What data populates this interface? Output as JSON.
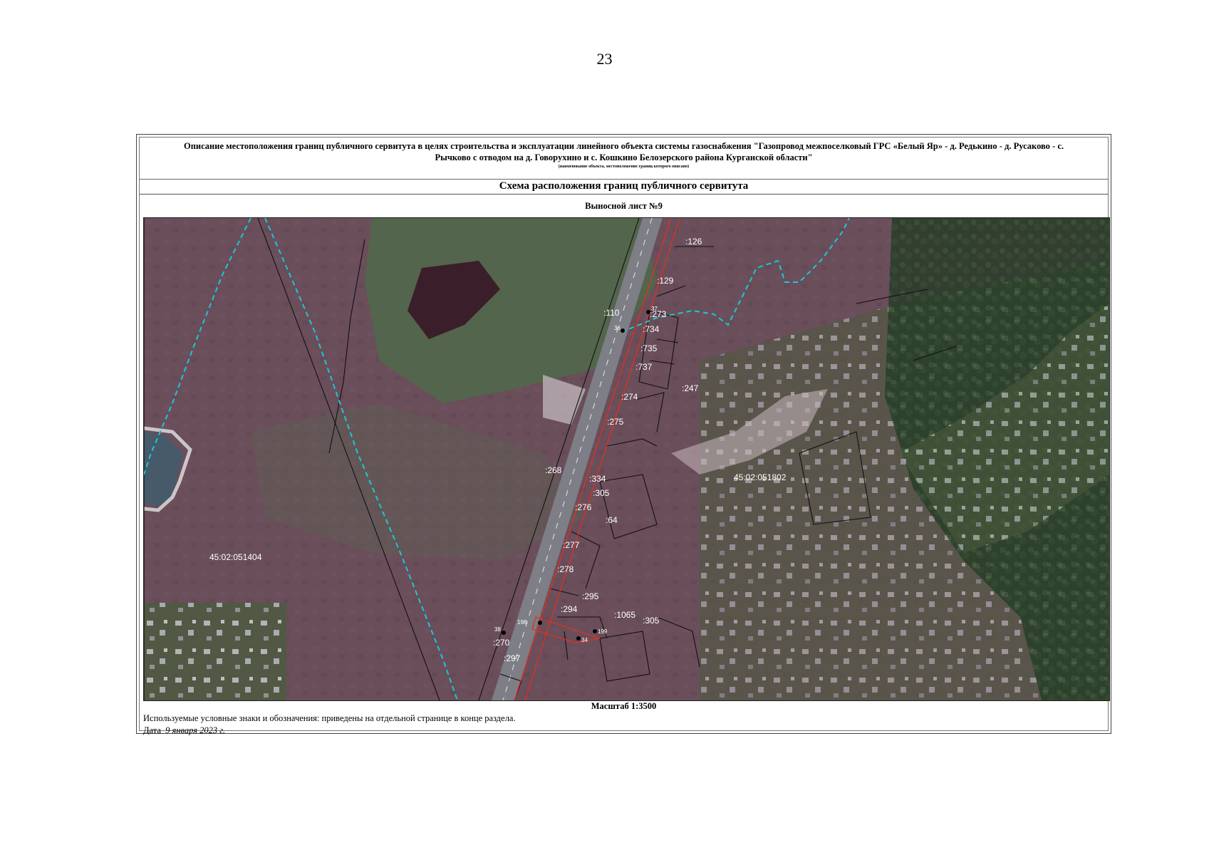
{
  "page_number": "23",
  "header": {
    "title": "Описание местоположения границ публичного сервитута в целях строительства и эксплуатации линейного объекта системы газоснабжения \"Газопровод межпоселковый ГРС «Белый Яр» - д. Редькино - д. Русаково - с. Рычково с отводом на д. Говорухино и с. Кошкино Белозерского района Курганской области\"",
    "subtitle": "(наименование объекта, местоположение границ которого описано)",
    "schema_title": "Схема расположения границ публичного сервитута",
    "sheet_title": "Выносной лист №9"
  },
  "map": {
    "labels": [
      ":126",
      ":129",
      ":110",
      ":273",
      ":734",
      ":735",
      ":737",
      ":274",
      ":247",
      ":275",
      ":268",
      ":334",
      ":305",
      ":276",
      ":64",
      ":277",
      ":278",
      ":295",
      ":294",
      ":1065",
      ":305",
      ":270",
      ":297",
      "45:02:051404",
      "45:02:051802"
    ],
    "point_labels": [
      "37",
      "36",
      "38",
      "198",
      "34",
      "199"
    ],
    "colors": {
      "water_boundary": "#19c9d4",
      "servitude_boundary": "#e03020",
      "parcel_lines": "#111111",
      "label_text": "#ffffff"
    }
  },
  "footer": {
    "scale": "Масштаб 1:3500",
    "legend_note": "Используемые условные знаки и обозначения: приведены на отдельной странице в конце раздела.",
    "date_label": "Дата",
    "date_value": "9 января 2023 г."
  }
}
